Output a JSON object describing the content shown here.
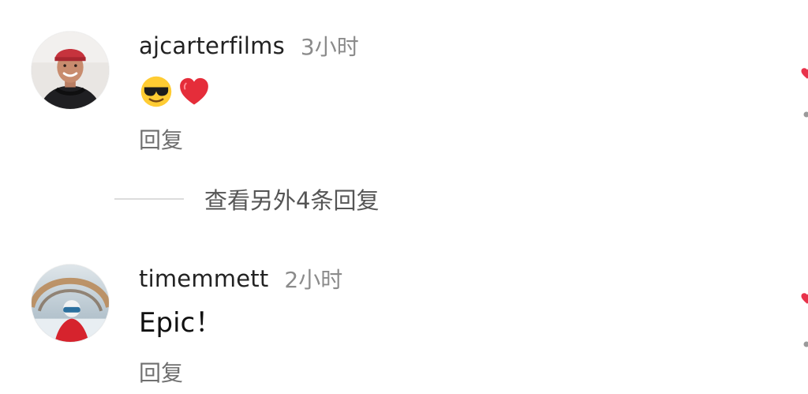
{
  "comments": [
    {
      "username": "ajcarterfilms",
      "time": "3小时",
      "content_emojis": [
        "smiling-face-with-sunglasses",
        "red-heart"
      ],
      "reply_label": "回复"
    },
    {
      "username": "timemmett",
      "time": "2小时",
      "content_text": "Epic！",
      "reply_label": "回复"
    }
  ],
  "more_replies": {
    "label": "查看另外4条回复"
  },
  "colors": {
    "username": "#222222",
    "time": "#8b8b8b",
    "reply": "#6f6f6f",
    "more_text": "#555555",
    "divider": "#dcdcdc",
    "like_accent": "#e8324a"
  },
  "icons": {
    "like": "heart-icon"
  }
}
